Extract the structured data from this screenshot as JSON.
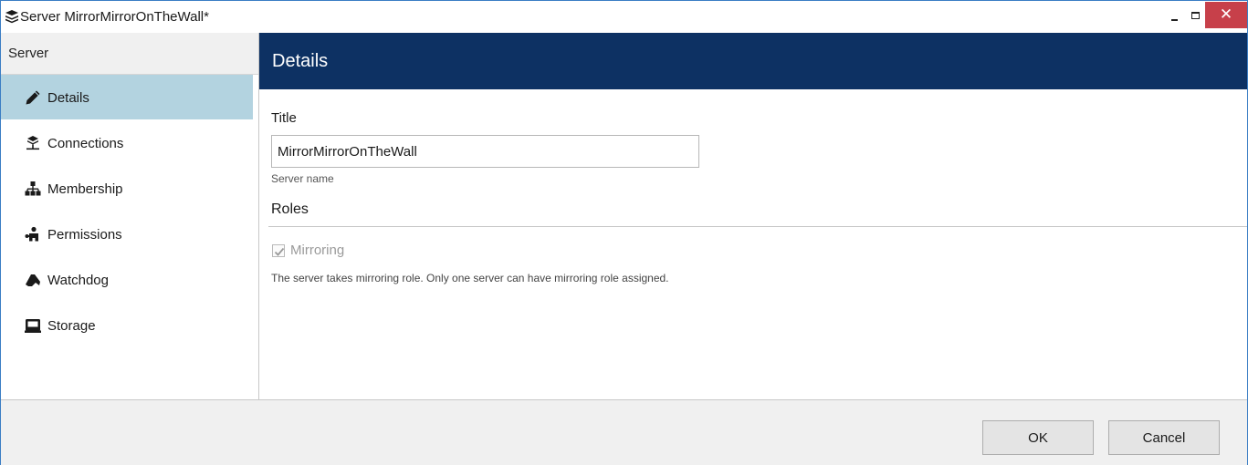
{
  "window": {
    "title": "Server MirrorMirrorOnTheWall*",
    "controls": {
      "minimize": "minimize",
      "maximize": "maximize",
      "close": "✕"
    }
  },
  "sidebar": {
    "header": "Server",
    "items": [
      {
        "label": "Details",
        "icon": "pencil-icon",
        "active": true
      },
      {
        "label": "Connections",
        "icon": "connections-icon",
        "active": false
      },
      {
        "label": "Membership",
        "icon": "membership-icon",
        "active": false
      },
      {
        "label": "Permissions",
        "icon": "permissions-icon",
        "active": false
      },
      {
        "label": "Watchdog",
        "icon": "watchdog-icon",
        "active": false
      },
      {
        "label": "Storage",
        "icon": "storage-icon",
        "active": false
      }
    ]
  },
  "main": {
    "header": "Details",
    "title_label": "Title",
    "title_value": "MirrorMirrorOnTheWall",
    "title_hint": "Server name",
    "roles_title": "Roles",
    "mirroring_label": "Mirroring",
    "mirroring_checked": true,
    "mirroring_description": "The server takes mirroring role. Only one server can have mirroring role assigned."
  },
  "footer": {
    "ok_label": "OK",
    "cancel_label": "Cancel"
  },
  "colors": {
    "header_bg": "#0d3163",
    "active_item_bg": "#b3d3e0",
    "close_button_bg": "#c7404a",
    "window_border": "#3b7ec4"
  }
}
